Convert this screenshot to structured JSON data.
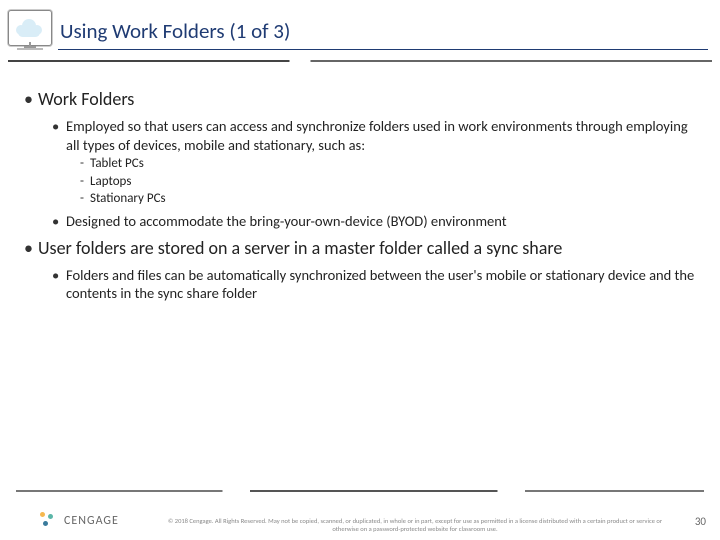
{
  "header": {
    "title": "Using Work Folders (1 of 3)"
  },
  "content": {
    "items": [
      {
        "text": "Work Folders",
        "children": [
          {
            "text": "Employed so that users can access and synchronize folders used in work environments through employing all types of devices, mobile and stationary, such as:",
            "children": [
              {
                "text": "Tablet PCs"
              },
              {
                "text": "Laptops"
              },
              {
                "text": "Stationary PCs"
              }
            ]
          },
          {
            "text": "Designed to accommodate the bring-your-own-device (BYOD) environment"
          }
        ]
      },
      {
        "text": "User folders are stored on a server in a master folder called a sync share",
        "children": [
          {
            "text": "Folders and files can be automatically synchronized between the user's mobile or stationary device and the contents in the sync share folder"
          }
        ]
      }
    ]
  },
  "footer": {
    "brand": "CENGAGE",
    "copyright": "© 2018 Cengage. All Rights Reserved. May not be copied, scanned, or duplicated, in whole or in part, except for use as permitted in a license distributed with a certain product or service or otherwise on a password-protected website for classroom use.",
    "page": "30"
  }
}
